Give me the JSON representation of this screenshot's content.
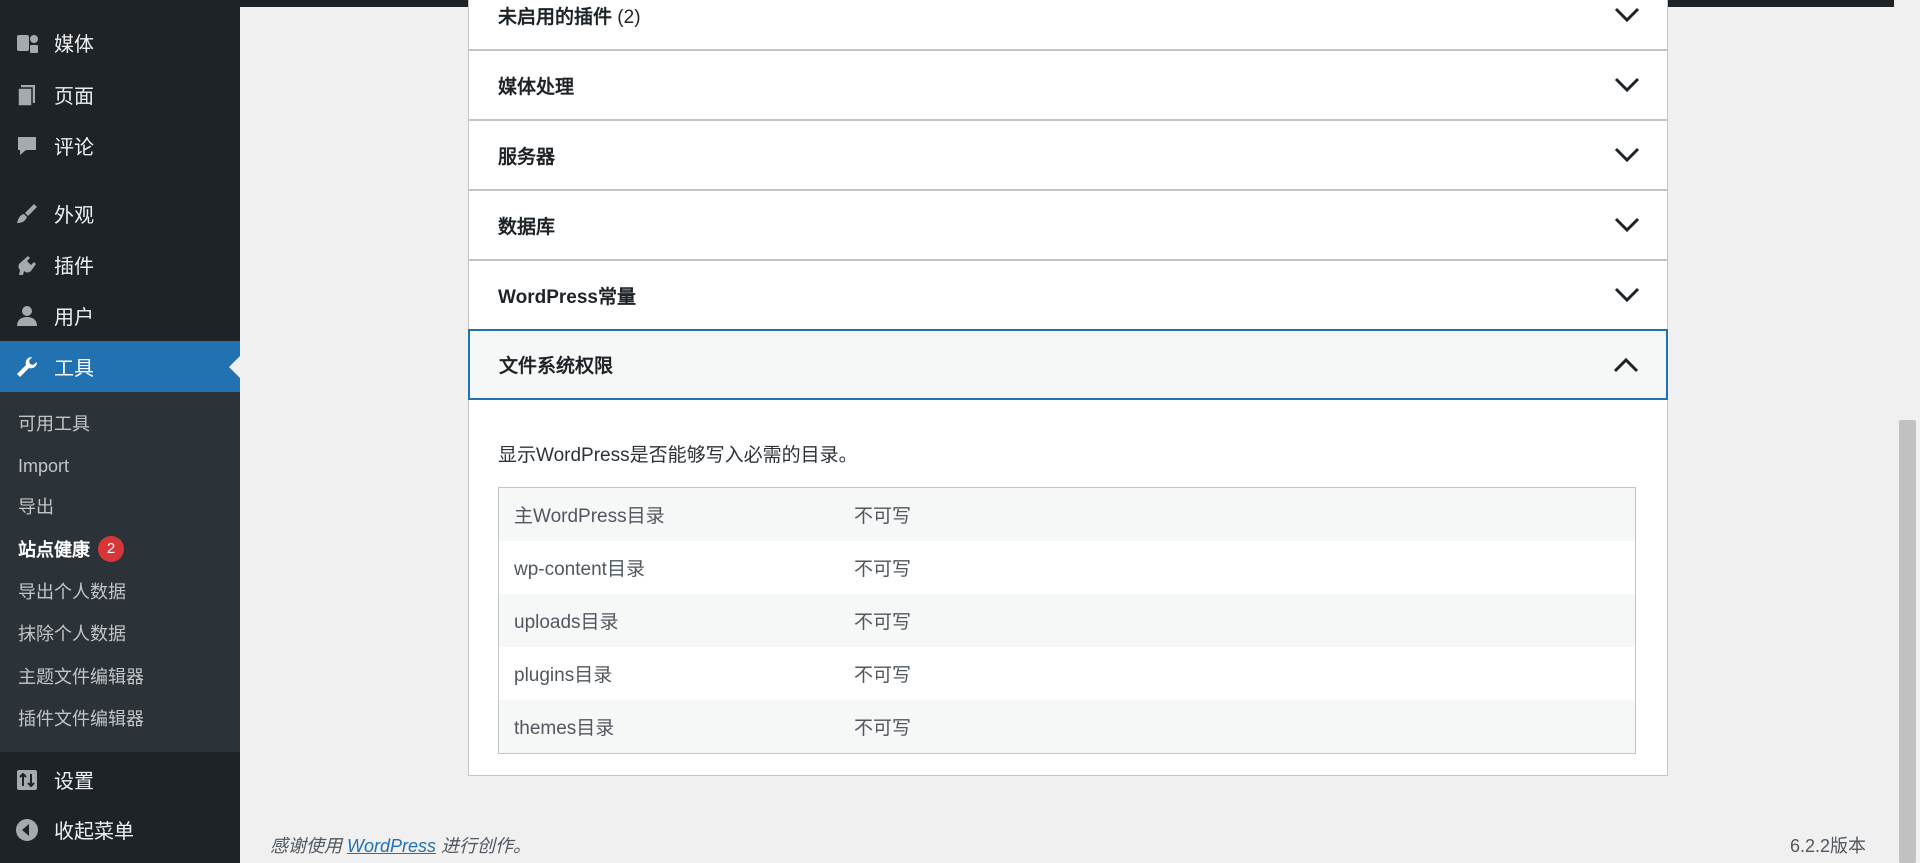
{
  "sidebar": {
    "items": [
      {
        "label": "媒体",
        "icon": "media-icon"
      },
      {
        "label": "页面",
        "icon": "pages-icon"
      },
      {
        "label": "评论",
        "icon": "comments-icon"
      },
      {
        "label": "外观",
        "icon": "appearance-icon"
      },
      {
        "label": "插件",
        "icon": "plugins-icon"
      },
      {
        "label": "用户",
        "icon": "users-icon"
      },
      {
        "label": "工具",
        "icon": "tools-icon",
        "current": true
      },
      {
        "label": "设置",
        "icon": "settings-icon"
      },
      {
        "label": "收起菜单",
        "icon": "collapse-icon"
      }
    ],
    "submenu": [
      {
        "label": "可用工具"
      },
      {
        "label": "Import"
      },
      {
        "label": "导出"
      },
      {
        "label": "站点健康",
        "active": true,
        "badge": "2"
      },
      {
        "label": "导出个人数据"
      },
      {
        "label": "抹除个人数据"
      },
      {
        "label": "主题文件编辑器"
      },
      {
        "label": "插件文件编辑器"
      }
    ]
  },
  "sections": [
    {
      "title": "未启用的插件",
      "count": "(2)"
    },
    {
      "title": "媒体处理"
    },
    {
      "title": "服务器"
    },
    {
      "title": "数据库"
    },
    {
      "title": "WordPress常量"
    },
    {
      "title": "文件系统权限",
      "expanded": true
    }
  ],
  "filesystem": {
    "description": "显示WordPress是否能够写入必需的目录。",
    "rows": [
      {
        "name": "主WordPress目录",
        "status": "不可写"
      },
      {
        "name": "wp-content目录",
        "status": "不可写"
      },
      {
        "name": "uploads目录",
        "status": "不可写"
      },
      {
        "name": "plugins目录",
        "status": "不可写"
      },
      {
        "name": "themes目录",
        "status": "不可写"
      }
    ]
  },
  "footer": {
    "thanks_prefix": "感谢使用",
    "link": "WordPress",
    "thanks_suffix": "进行创作。",
    "version": "6.2.2版本"
  },
  "colors": {
    "accent": "#2271b1",
    "sidebar_bg": "#1d2327",
    "badge": "#d63638"
  }
}
